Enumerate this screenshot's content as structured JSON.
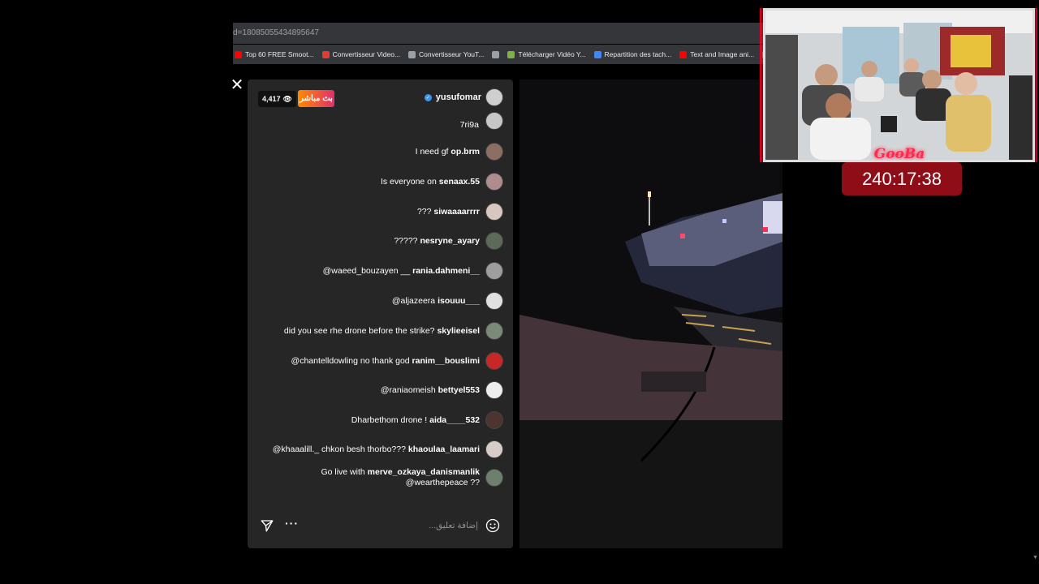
{
  "browser": {
    "url_fragment": "d=18085055434895647",
    "bookmarks": [
      {
        "label": "Top 60 FREE Smoot...",
        "icon": "youtube-icon",
        "color": "#ff0000"
      },
      {
        "label": "Convertisseur Video...",
        "icon": "z-icon",
        "color": "#e53935"
      },
      {
        "label": "Convertisseur YouT...",
        "icon": "converter-icon",
        "color": "#9aa0a6"
      },
      {
        "label": "",
        "icon": "globe-icon",
        "color": "#9aa0a6"
      },
      {
        "label": "Télécharger Vidéo Y...",
        "icon": "download-icon",
        "color": "#7cb342"
      },
      {
        "label": "Repartition des tach...",
        "icon": "docs-icon",
        "color": "#4285f4"
      },
      {
        "label": "Text and Image ani...",
        "icon": "youtube-icon",
        "color": "#ff0000"
      },
      {
        "label": "",
        "icon": "audio-icon",
        "color": "#ff9800"
      }
    ]
  },
  "live": {
    "viewer_count": "4,417",
    "live_label": "بث مباشر",
    "host": "yusufomar",
    "partial_comment": "7ri9a",
    "comments": [
      {
        "user": "op.brm",
        "text": "I need gf",
        "avatar_color": "#8d6e63"
      },
      {
        "user": "senaax.55",
        "text": "Is everyone on",
        "avatar_color": "#b08d8d"
      },
      {
        "user": "siwaaaarrrr",
        "text": "???",
        "avatar_color": "#d7c7c0"
      },
      {
        "user": "nesryne_ayary",
        "text": "?????",
        "avatar_color": "#5d6a5a"
      },
      {
        "user": "rania.dahmeni__",
        "text": "@waeed_bouzayen __",
        "avatar_color": "#9e9e9e"
      },
      {
        "user": "isouuu___",
        "text": "@aljazeera",
        "avatar_color": "#e0e0e0"
      },
      {
        "user": "skylieeisel",
        "text": "did you see rhe drone before the strike?",
        "avatar_color": "#7a8a78"
      },
      {
        "user": "ranim__bouslimi",
        "text": "@chantelldowling no thank god",
        "avatar_color": "#c62828"
      },
      {
        "user": "bettyel553",
        "text": "@raniaomeish",
        "avatar_color": "#eeeeee"
      },
      {
        "user": "aida____532",
        "text": "Dharbethom drone !",
        "avatar_color": "#4e342e"
      },
      {
        "user": "khaoulaa_laamari",
        "text": "@khaaalill._ chkon besh thorbo???",
        "avatar_color": "#d7ccc8"
      },
      {
        "user": "merve_ozkaya_danismanlik",
        "text": "Go live with",
        "text2": "@wearthepeace ??",
        "avatar_color": "#6d7f6d"
      }
    ],
    "comment_placeholder": "إضافة تعليق..."
  },
  "overlay": {
    "brand": "GooBa",
    "timer": "240:17:38"
  }
}
